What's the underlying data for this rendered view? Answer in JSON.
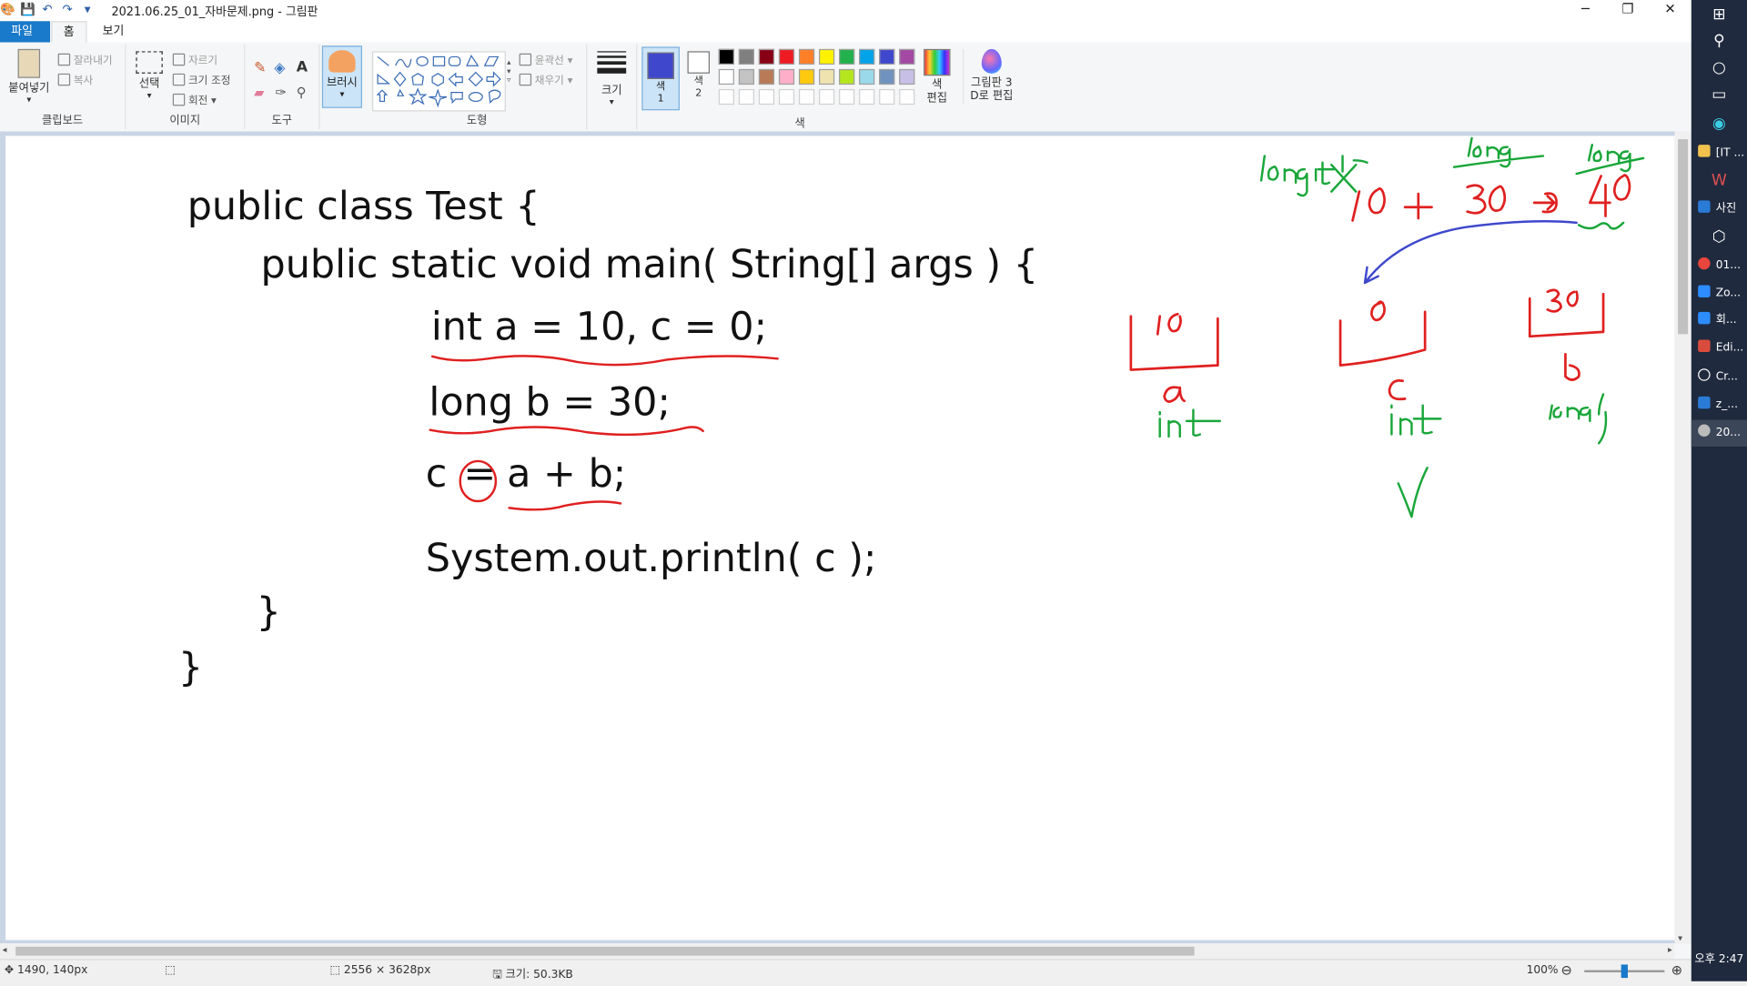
{
  "window": {
    "title": "2021.06.25_01_자바문제.png - 그림판",
    "controls": [
      "─",
      "❐",
      "✕"
    ]
  },
  "menu": {
    "file": "파일",
    "home": "홈",
    "view": "보기"
  },
  "ribbon": {
    "clipboard": {
      "paste": "붙여넣기",
      "cut": "잘라내기",
      "copy": "복사",
      "group": "클립보드"
    },
    "image": {
      "select": "선택",
      "crop": "자르기",
      "resize": "크기 조정",
      "rotate": "회전",
      "group": "이미지"
    },
    "tools": {
      "group": "도구"
    },
    "brush": {
      "label": "브러시"
    },
    "shapes": {
      "outline": "윤곽선",
      "fill": "채우기",
      "group": "도형"
    },
    "size": {
      "label": "크기"
    },
    "color1": {
      "label": "색",
      "num": "1",
      "value": "#3f48cc"
    },
    "color2": {
      "label": "색",
      "num": "2",
      "value": "#ffffff"
    },
    "edit_colors": {
      "line1": "색",
      "line2": "편집"
    },
    "paint3d": {
      "line1": "그림판 3",
      "line2": "D로 편집"
    },
    "colors_group": "색",
    "palette": [
      [
        "#000000",
        "#7f7f7f",
        "#880015",
        "#ed1c24",
        "#ff7f27",
        "#fff200",
        "#22b14c",
        "#00a2e8",
        "#3f48cc",
        "#a349a4"
      ],
      [
        "#ffffff",
        "#c3c3c3",
        "#b97a57",
        "#ffaec9",
        "#ffc90e",
        "#efe4b0",
        "#b5e61d",
        "#99d9ea",
        "#7092be",
        "#c8bfe7"
      ]
    ]
  },
  "code": {
    "line1": "public class Test {",
    "line2": "public static void main( String[] args ) {",
    "line3": "int a = 10, c = 0;",
    "line4": "long b = 30;",
    "line5_c": "c",
    "line5_eq": "=",
    "line5_rest": "a + b;",
    "line6": "System.out.println( c );",
    "line7": "}",
    "line8": "}"
  },
  "status": {
    "position": "1490, 140px",
    "dimensions": "2556 × 3628px",
    "filesize": "크기: 50.3KB",
    "zoom": "100%"
  },
  "taskbar": {
    "items": [
      "[IT ...",
      "사진",
      "01...",
      "Zo...",
      "회...",
      "Edi...",
      "Cr...",
      "z_...",
      "20..."
    ],
    "clock": "오후 2:47"
  }
}
